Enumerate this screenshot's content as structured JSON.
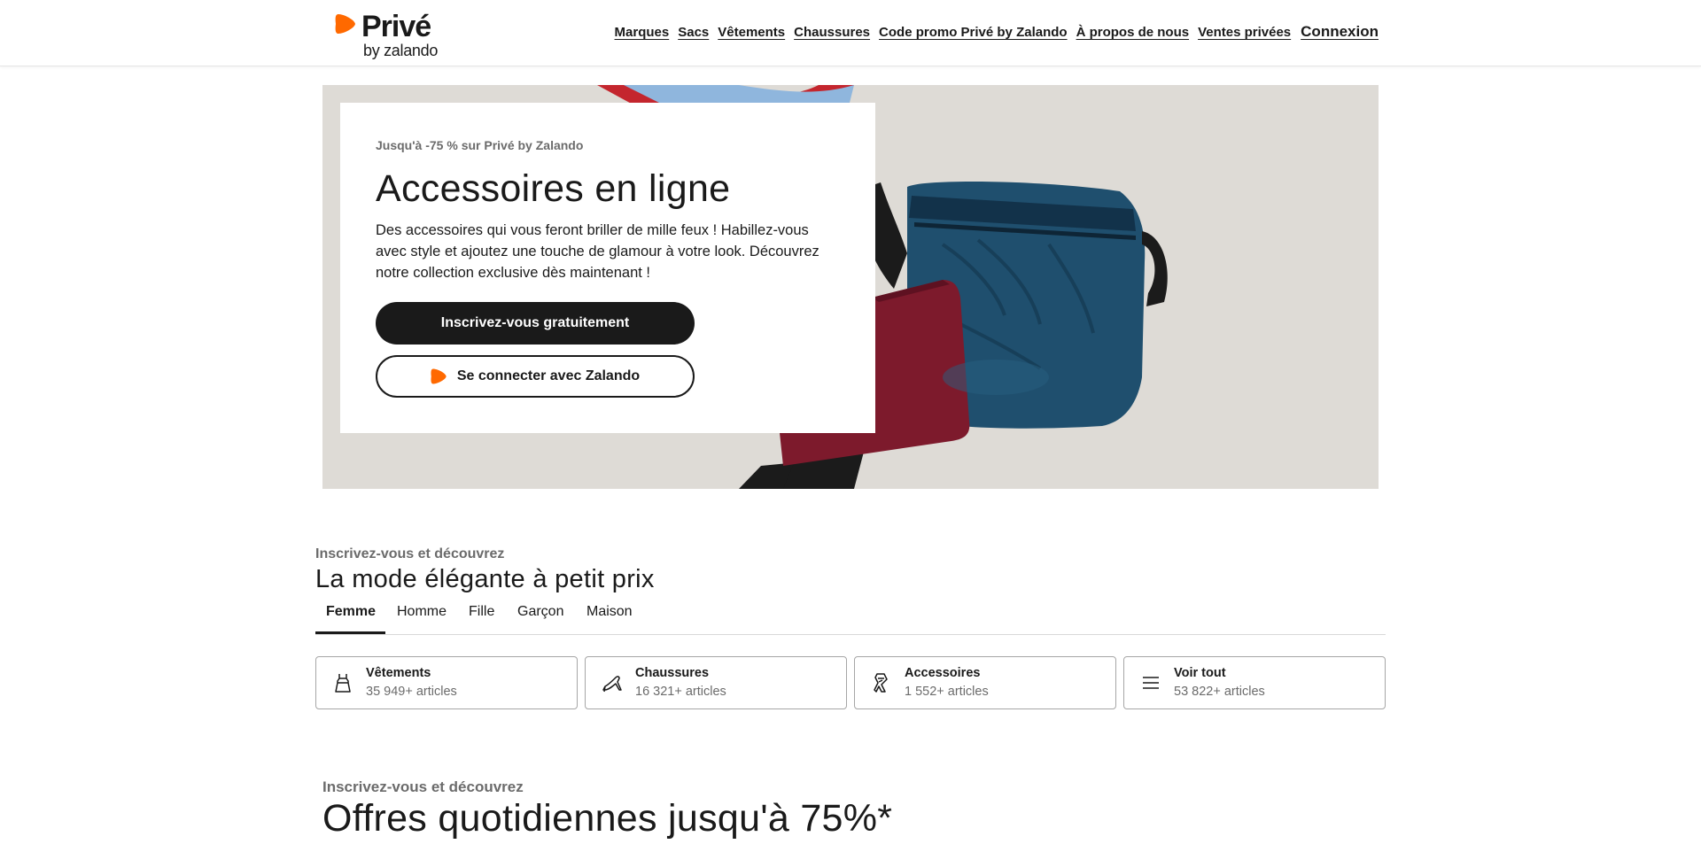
{
  "header": {
    "logo": {
      "brand": "Privé",
      "sub": "by zalando"
    },
    "nav": [
      "Marques",
      "Sacs",
      "Vêtements",
      "Chaussures",
      "Code promo Privé by Zalando",
      "À propos de nous",
      "Ventes privées"
    ],
    "login": "Connexion"
  },
  "hero": {
    "eyebrow": "Jusqu'à -75 % sur Privé by Zalando",
    "title": "Accessoires en ligne",
    "description": "Des accessoires qui vous feront briller de mille feux ! Habillez-vous avec style et ajoutez une touche de glamour à votre look. Découvrez notre collection exclusive dès maintenant !",
    "signup_button": "Inscrivez-vous gratuitement",
    "connect_button": "Se connecter avec Zalando"
  },
  "section_categories": {
    "eyebrow": "Inscrivez-vous et découvrez",
    "title": "La mode élégante à petit prix",
    "tabs": [
      "Femme",
      "Homme",
      "Fille",
      "Garçon",
      "Maison"
    ],
    "active_tab": "Femme",
    "cards": [
      {
        "title": "Vêtements",
        "count": "35 949+ articles",
        "icon": "dress-icon"
      },
      {
        "title": "Chaussures",
        "count": "16 321+ articles",
        "icon": "shoe-icon"
      },
      {
        "title": "Accessoires",
        "count": "1 552+ articles",
        "icon": "scarf-icon"
      },
      {
        "title": "Voir tout",
        "count": "53 822+ articles",
        "icon": "menu-icon"
      }
    ]
  },
  "section_offers": {
    "eyebrow": "Inscrivez-vous et découvrez",
    "title": "Offres quotidiennes jusqu'à 75%*"
  },
  "colors": {
    "brand_orange": "#ff6900",
    "text_primary": "#1a1a1a",
    "text_muted": "#6b6b6b",
    "hero_background": "#dedbd6"
  }
}
